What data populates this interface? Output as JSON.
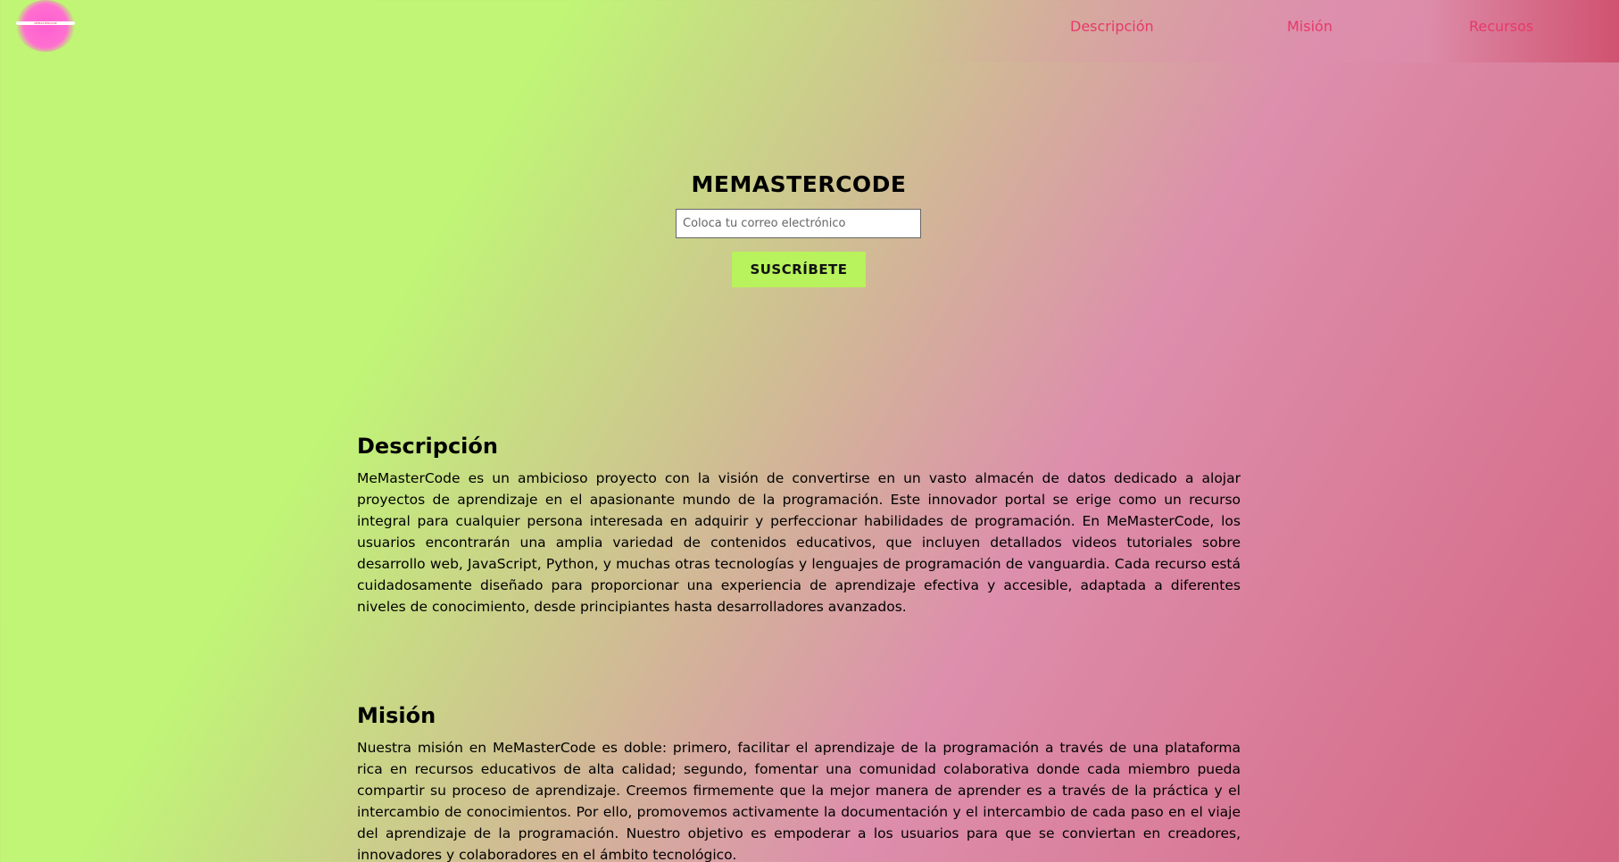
{
  "header": {
    "logo_text": "MEMASTERCODE",
    "nav": [
      {
        "label": "Descripción"
      },
      {
        "label": "Misión"
      },
      {
        "label": "Recursos"
      }
    ]
  },
  "hero": {
    "title": "MEMASTERCODE",
    "email_placeholder": "Coloca tu correo electrónico",
    "subscribe_label": "SUSCRÍBETE"
  },
  "sections": {
    "descripcion": {
      "title": "Descripción",
      "body": "MeMasterCode es un ambicioso proyecto con la visión de convertirse en un vasto almacén de datos dedicado a alojar proyectos de aprendizaje en el apasionante mundo de la programación. Este innovador portal se erige como un recurso integral para cualquier persona interesada en adquirir y perfeccionar habilidades de programación. En MeMasterCode, los usuarios encontrarán una amplia variedad de contenidos educativos, que incluyen detallados videos tutoriales sobre desarrollo web, JavaScript, Python, y muchas otras tecnologías y lenguajes de programación de vanguardia. Cada recurso está cuidadosamente diseñado para proporcionar una experiencia de aprendizaje efectiva y accesible, adaptada a diferentes niveles de conocimiento, desde principiantes hasta desarrolladores avanzados."
    },
    "mision": {
      "title": "Misión",
      "body": "Nuestra misión en MeMasterCode es doble: primero, facilitar el aprendizaje de la programación a través de una plataforma rica en recursos educativos de alta calidad; segundo, fomentar una comunidad colaborativa donde cada miembro pueda compartir su proceso de aprendizaje. Creemos firmemente que la mejor manera de aprender es a través de la práctica y el intercambio de conocimientos. Por ello, promovemos activamente la documentación y el intercambio de cada paso en el viaje del aprendizaje de la programación. Nuestro objetivo es empoderar a los usuarios para que se conviertan en creadores, innovadores y colaboradores en el ámbito tecnológico."
    }
  },
  "colors": {
    "background_start": "#c0f576",
    "background_end": "#d46582",
    "nav_link": "#e8386a",
    "button": "#b8f25c",
    "logo": "#ff5fd0"
  }
}
